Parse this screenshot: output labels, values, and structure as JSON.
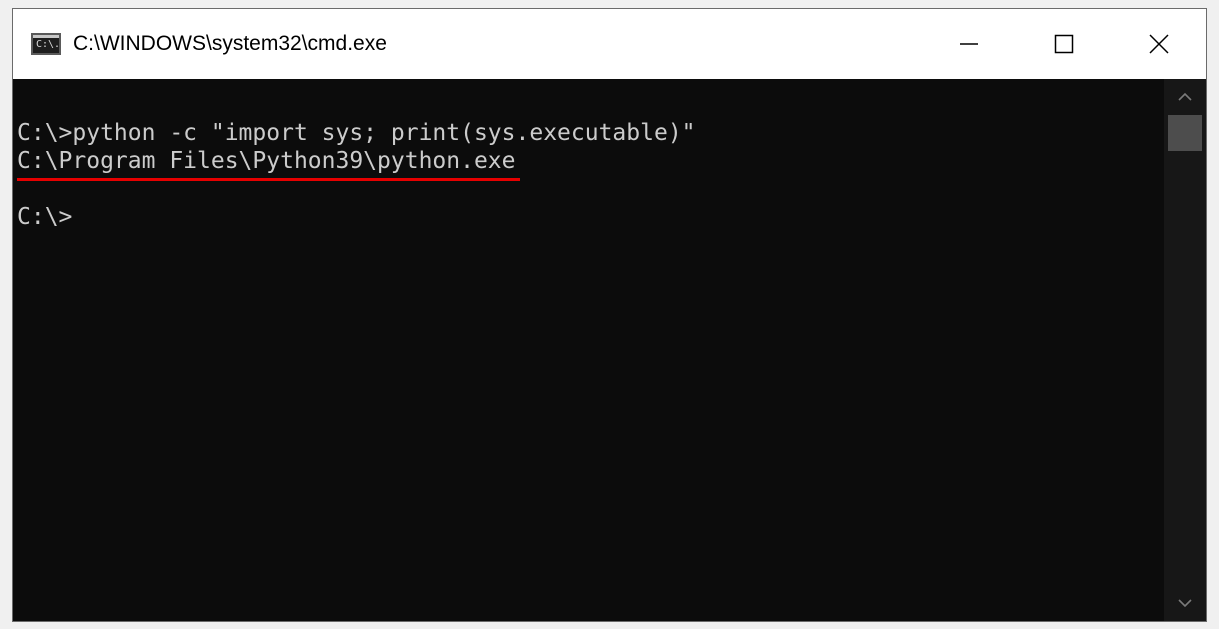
{
  "window": {
    "title": "C:\\WINDOWS\\system32\\cmd.exe",
    "icon_label": "C:\\.",
    "icon": "console-app-icon"
  },
  "controls": {
    "minimize_icon": "minimize-icon",
    "maximize_icon": "maximize-icon",
    "close_icon": "close-icon"
  },
  "console": {
    "lines": [
      "C:\\>python -c \"import sys; print(sys.executable)\"",
      "C:\\Program Files\\Python39\\python.exe",
      "",
      "C:\\>"
    ],
    "highlighted_line_index": 1,
    "highlight_color": "#e60000",
    "text_color": "#cccccc",
    "background_color": "#0c0c0c"
  },
  "scrollbar": {
    "up_icon": "chevron-up-icon",
    "down_icon": "chevron-down-icon"
  }
}
